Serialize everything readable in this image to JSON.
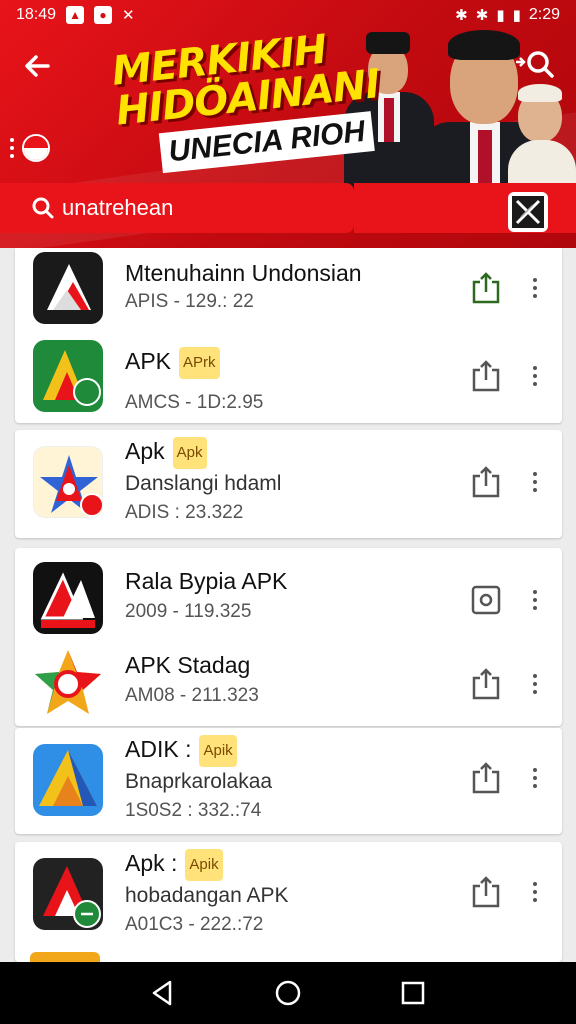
{
  "status_bar": {
    "time": "18:49",
    "right_time": "2:29",
    "icons": [
      "photo-icon",
      "notification-icon",
      "close-x-icon",
      "bluetooth-icon",
      "vibrate-icon",
      "signal-icon",
      "battery-icon"
    ]
  },
  "banner": {
    "headline_line1": "MERKIKIH",
    "headline_line2": "HIDÖAINANI",
    "headline_line3": "UNECIA RIOH",
    "search_placeholder": "unatrehean"
  },
  "apps": [
    {
      "title": "Mtenuhainn Undonsian",
      "badge": "",
      "subtitle": "",
      "meta": "APIS - 129.: 22",
      "action_icon": "share-icon",
      "action_color": "#2d6a1f"
    },
    {
      "title": "APK",
      "badge": "APrk",
      "subtitle": "",
      "meta": "AMCS - 1D:2.95",
      "action_icon": "share-icon",
      "action_color": "#555555"
    },
    {
      "title": "Apk",
      "badge": "Apk",
      "subtitle": "Danslangi hdaml",
      "meta": "ADIS : 23.322",
      "action_icon": "share-icon",
      "action_color": "#555555"
    },
    {
      "title": "Rala Bypia APK",
      "badge": "",
      "subtitle": "",
      "meta": "2009 - 119.325",
      "action_icon": "camera-icon",
      "action_color": "#555555"
    },
    {
      "title": "APK Stadag",
      "badge": "",
      "subtitle": "",
      "meta": "AM08 - 211.323",
      "action_icon": "share-icon",
      "action_color": "#555555"
    },
    {
      "title": "ADIK :",
      "badge": "Apik",
      "subtitle": "Bnaprkarolakaa",
      "meta": "1S0S2 : 332.:74",
      "action_icon": "share-icon",
      "action_color": "#555555"
    },
    {
      "title": "Apk :",
      "badge": "Apik",
      "subtitle": "hobadangan APK",
      "meta": "A01C3 - 222.:72",
      "action_icon": "share-icon",
      "action_color": "#555555"
    }
  ],
  "colors": {
    "accent": "#e8141a",
    "headline": "#ffe200",
    "badge_bg": "#ffe37a"
  }
}
